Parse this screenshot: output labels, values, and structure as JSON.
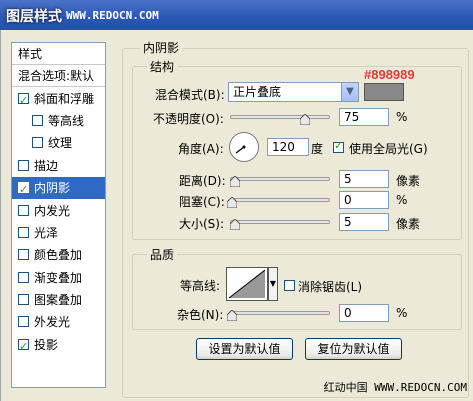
{
  "titlebar": {
    "title": "图层样式",
    "site": "WWW.REDOCN.COM"
  },
  "left_panel": {
    "header": "样式",
    "blend_options": "混合选项:默认",
    "items": [
      {
        "label": "斜面和浮雕",
        "checked": true
      },
      {
        "label": "等高线",
        "checked": false
      },
      {
        "label": "纹理",
        "checked": false
      },
      {
        "label": "描边",
        "checked": false
      },
      {
        "label": "内阴影",
        "checked": true,
        "selected": true
      },
      {
        "label": "内发光",
        "checked": false
      },
      {
        "label": "光泽",
        "checked": false
      },
      {
        "label": "颜色叠加",
        "checked": false
      },
      {
        "label": "渐变叠加",
        "checked": false
      },
      {
        "label": "图案叠加",
        "checked": false
      },
      {
        "label": "外发光",
        "checked": false
      },
      {
        "label": "投影",
        "checked": true
      }
    ]
  },
  "panel": {
    "title": "内阴影",
    "structure": {
      "legend": "结构",
      "blend_mode_label": "混合模式(B):",
      "blend_mode_value": "正片叠底",
      "color_hex_label": "#898989",
      "color": "#898989",
      "opacity_label": "不透明度(O):",
      "opacity_value": "75",
      "opacity_unit": "%",
      "opacity_level": 0.75,
      "angle_label": "角度(A):",
      "angle_value": "120",
      "angle_unit": "度",
      "global_light_label": "使用全局光(G)",
      "global_light_checked": true,
      "distance_label": "距离(D):",
      "distance_value": "5",
      "distance_unit": "像素",
      "choke_label": "阻塞(C):",
      "choke_value": "0",
      "choke_unit": "%",
      "size_label": "大小(S):",
      "size_value": "5",
      "size_unit": "像素"
    },
    "quality": {
      "legend": "品质",
      "contour_label": "等高线:",
      "anti_alias_label": "消除锯齿(L)",
      "anti_alias_checked": false,
      "noise_label": "杂色(N):",
      "noise_value": "0",
      "noise_unit": "%"
    },
    "buttons": {
      "make_default": "设置为默认值",
      "reset_default": "复位为默认值"
    }
  },
  "watermark": "红动中国 WWW.REDOCN.COM"
}
